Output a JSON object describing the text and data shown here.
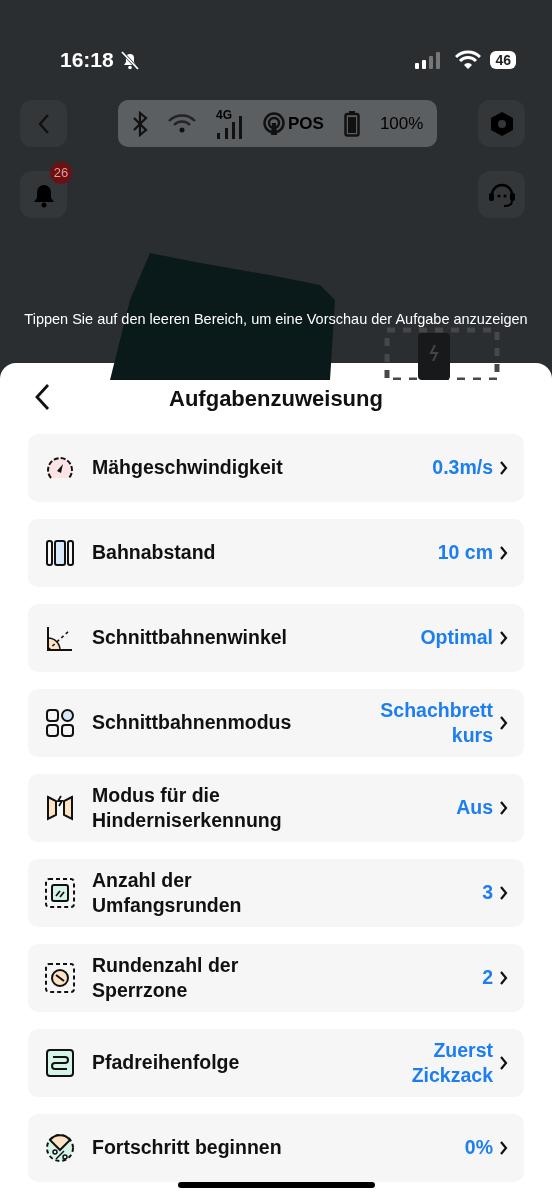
{
  "status_bar": {
    "time": "16:18",
    "battery": "46"
  },
  "toolbar": {
    "network_label": "4G",
    "positioning": "POS",
    "battery": "100%"
  },
  "notifications": {
    "count": "26"
  },
  "hint": "Tippen Sie auf den leeren Bereich, um eine Vorschau der Aufgabe anzuzeigen",
  "sheet": {
    "title": "Aufgabenzuweisung"
  },
  "settings": [
    {
      "label": "Mähgeschwindigkeit",
      "value": "0.3m/s"
    },
    {
      "label": "Bahnabstand",
      "value": "10 cm"
    },
    {
      "label": "Schnittbahnenwinkel",
      "value": "Optimal"
    },
    {
      "label": "Schnittbahnenmodus",
      "value": "Schachbrettkurs"
    },
    {
      "label": "Modus für die Hinderniserkennung",
      "value": "Aus"
    },
    {
      "label": "Anzahl der Umfangsrunden",
      "value": "3"
    },
    {
      "label": "Rundenzahl der Sperrzone",
      "value": "2"
    },
    {
      "label": "Pfadreihenfolge",
      "value": "Zuerst Zickzack"
    },
    {
      "label": "Fortschritt beginnen",
      "value": "0%"
    }
  ]
}
